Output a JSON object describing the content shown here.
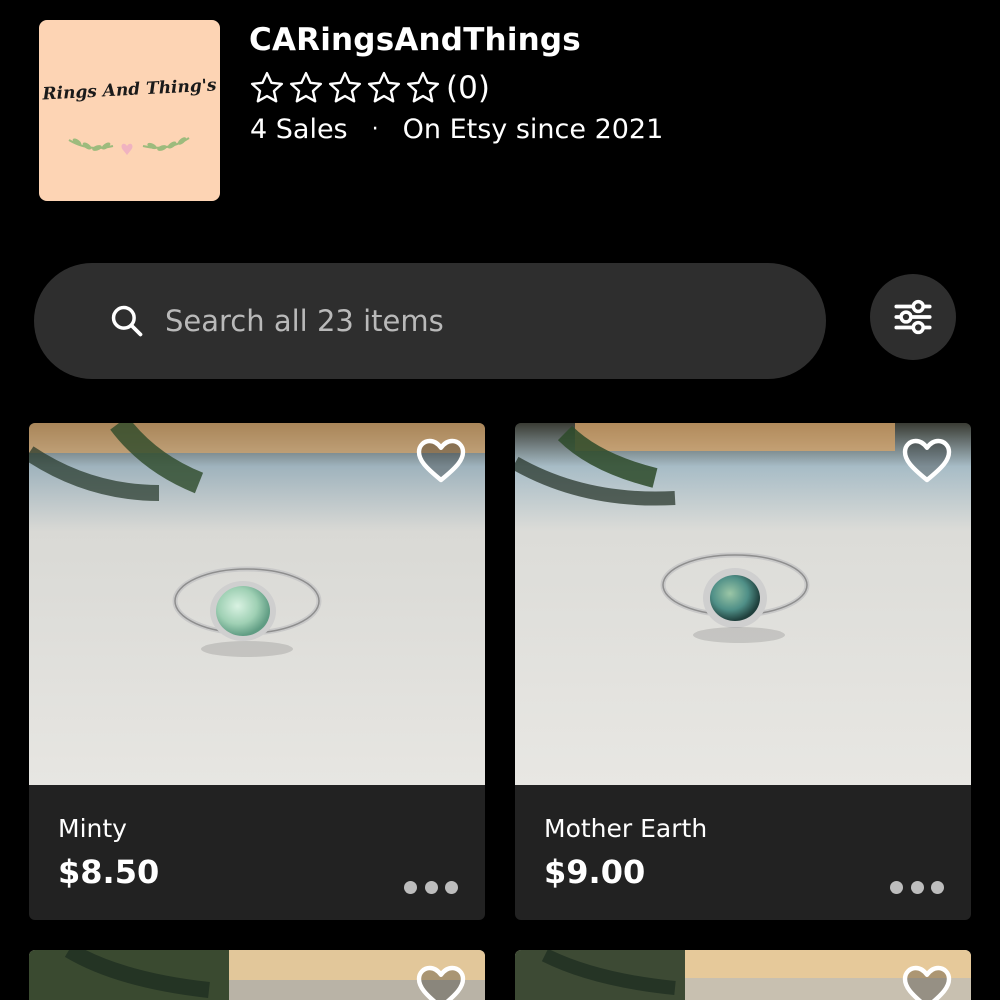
{
  "shop": {
    "logo_text": "Rings And Thing's",
    "name": "CARingsAndThings",
    "rating_stars": 0,
    "rating_max": 5,
    "rating_count": "(0)",
    "sales": "4 Sales",
    "separator": "·",
    "since": "On Etsy since 2021"
  },
  "search": {
    "placeholder": "Search all 23 items",
    "icon": "search-icon"
  },
  "filter": {
    "icon": "sliders-icon"
  },
  "listings": [
    {
      "title": "Minty",
      "price": "$8.50",
      "stone_color": "#9fd0b4",
      "favorited": false
    },
    {
      "title": "Mother Earth",
      "price": "$9.00",
      "stone_color": "#4f8f87",
      "favorited": false
    },
    {
      "favorited": false
    },
    {
      "favorited": false
    }
  ],
  "colors": {
    "background": "#000000",
    "surface": "#2e2e2e",
    "card_footer": "#222222",
    "logo_background": "#fdd4b4",
    "text": "#ffffff",
    "muted_text": "#b9b9b9"
  }
}
